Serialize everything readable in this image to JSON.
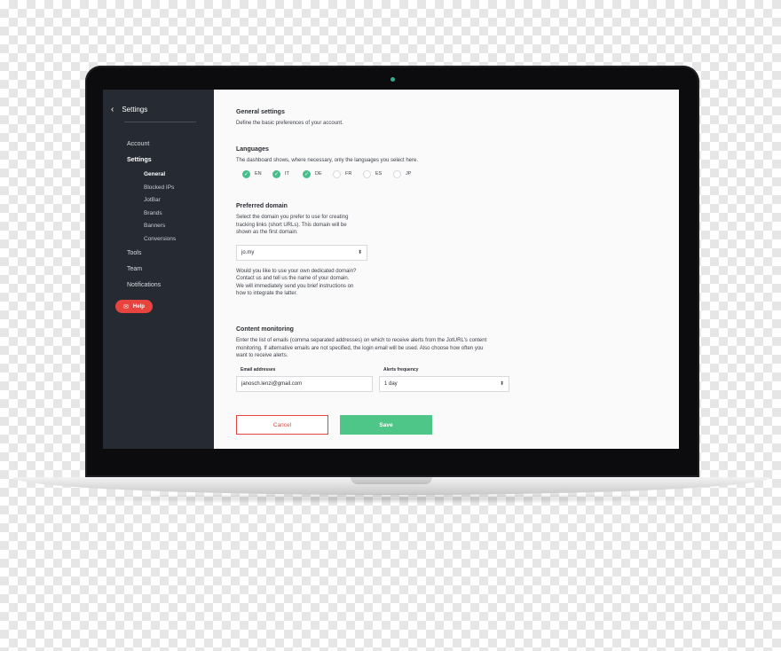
{
  "sidebar": {
    "title": "Settings",
    "items": [
      {
        "label": "Account"
      },
      {
        "label": "Settings"
      },
      {
        "label": "Tools"
      },
      {
        "label": "Team"
      },
      {
        "label": "Notifications"
      }
    ],
    "sub_items": [
      {
        "label": "General"
      },
      {
        "label": "Blocked IPs"
      },
      {
        "label": "JotBar"
      },
      {
        "label": "Brands"
      },
      {
        "label": "Banners"
      },
      {
        "label": "Conversions"
      }
    ],
    "help_label": "Help"
  },
  "general": {
    "title": "General settings",
    "description": "Define the basic preferences of your account."
  },
  "languages": {
    "title": "Languages",
    "description": "The dashboard shows, where necessary, only the languages you select here.",
    "options": [
      {
        "code": "EN",
        "checked": true
      },
      {
        "code": "IT",
        "checked": true
      },
      {
        "code": "DE",
        "checked": true
      },
      {
        "code": "FR",
        "checked": false
      },
      {
        "code": "ES",
        "checked": false
      },
      {
        "code": "JP",
        "checked": false
      }
    ]
  },
  "domain": {
    "title": "Preferred domain",
    "description_1": "Select the domain you prefer to use for creating",
    "description_2": "tracking links (short URLs). This domain will be",
    "description_3": "shown as the first domain.",
    "selected": "jo.my",
    "question": "Would you like to use your own dedicated domain?",
    "note_1": "Contact us and tell us the name of your domain.",
    "note_2": "We will immediately send you brief instructions on",
    "note_3": "how to integrate the latter."
  },
  "monitoring": {
    "title": "Content monitoring",
    "description_1": "Enter the list of emails (comma separated addresses) on which to receive alerts from the JotURL's content",
    "description_2": "monitoring. If alternative emails are not specified, the login email will be used. Also choose how often you",
    "description_3": "want to receive alerts.",
    "email_label": "Email addresses",
    "email_value": "janosch.lenzi@gmail.com",
    "frequency_label": "Alerts frequency",
    "frequency_value": "1 day"
  },
  "actions": {
    "cancel_label": "Cancel",
    "save_label": "Save"
  },
  "colors": {
    "sidebar_bg": "#262a33",
    "accent_green": "#4ec687",
    "accent_red": "#e8443f"
  }
}
